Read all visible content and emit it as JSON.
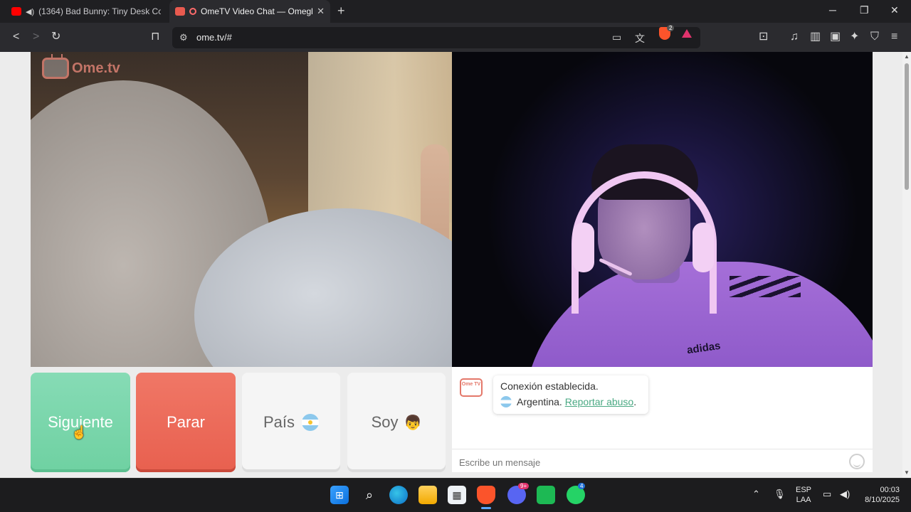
{
  "browser": {
    "tabs": [
      {
        "title": "(1364) Bad Bunny: Tiny Desk Con",
        "favicon": "youtube-icon",
        "audio": true
      },
      {
        "title": "OmeTV Video Chat — Omegl",
        "favicon": "ometv-icon",
        "recording": true
      }
    ],
    "url": "ome.tv/#",
    "shields_count": "2"
  },
  "watermark": {
    "text": "Ome.tv"
  },
  "buttons": {
    "next": "Siguiente",
    "stop": "Parar",
    "country": "País",
    "me": "Soy"
  },
  "chat": {
    "avatar_text": "Ome TV",
    "status": "Conexión establecida.",
    "country": "Argentina.",
    "report_link": "Reportar abuso",
    "report_suffix": ".",
    "input_placeholder": "Escribe un mensaje"
  },
  "remote_video": {
    "shirt_brand": "adidas"
  },
  "taskbar": {
    "discord_badge": "9+",
    "whatsapp_badge": "4",
    "lang_line1": "ESP",
    "lang_line2": "LAA",
    "time": "00:03",
    "date": "8/10/2025"
  },
  "colors": {
    "next": "#6fd1a2",
    "stop": "#e8604f",
    "link": "#4aa983",
    "brand": "#ef8b7c"
  }
}
